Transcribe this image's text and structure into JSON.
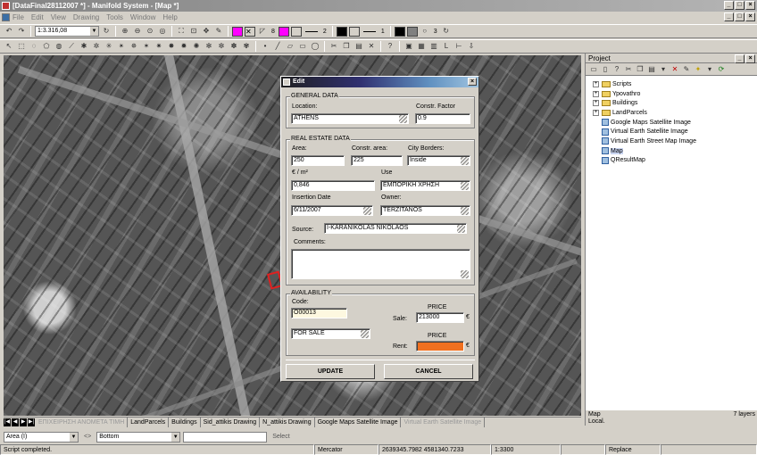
{
  "window": {
    "title": "[DataFinal28112007 *] - Manifold System - [Map *]"
  },
  "menu": [
    "File",
    "Edit",
    "View",
    "Drawing",
    "Tools",
    "Window",
    "Help"
  ],
  "toolbar": {
    "scale": "1:3.316,08",
    "swatch_pink": "#ff00ff",
    "num8": "8",
    "num2": "2",
    "num1": "1",
    "num3": "3"
  },
  "map": {
    "tabs": [
      "ΕΠΙΧΕΙΡΗΣΗ ΑΝΟΜΕΤΑ ΤΙΜΗ",
      "LandParcels",
      "Buildings",
      "Sid_attikis Drawing",
      "N_attikis Drawing",
      "Google Maps Satellite Image",
      "Virtual Earth Satellite Image"
    ]
  },
  "filter": {
    "field": "Area (I)",
    "op": "<>",
    "value": "Bottom",
    "select_label": "Select"
  },
  "status": {
    "message": "Script completed.",
    "projection": "Mercator",
    "coords": "2639345.7982  4581340.7233",
    "scale": "1:3300",
    "mode": "Replace"
  },
  "project": {
    "title": "Project",
    "items": [
      {
        "label": "Scripts",
        "kind": "folder",
        "expand": "+"
      },
      {
        "label": "Ypovathro",
        "kind": "folder",
        "expand": "+"
      },
      {
        "label": "Buildings",
        "kind": "folder",
        "expand": "+"
      },
      {
        "label": "LandParcels",
        "kind": "folder",
        "expand": "+"
      },
      {
        "label": "Google Maps Satellite Image",
        "kind": "image",
        "expand": ""
      },
      {
        "label": "Virtual Earth Satellite Image",
        "kind": "image",
        "expand": ""
      },
      {
        "label": "Virtual Earth Street Map Image",
        "kind": "image",
        "expand": ""
      },
      {
        "label": "Map",
        "kind": "map",
        "expand": ""
      },
      {
        "label": "QResultMap",
        "kind": "map",
        "expand": ""
      }
    ],
    "footer_left": "Map",
    "footer_left2": "Local.",
    "footer_right": "7 layers"
  },
  "dialog": {
    "title": "Edit",
    "general": {
      "legend": "GENERAL DATA",
      "location_label": "Location:",
      "location": "ATHENS",
      "factor_label": "Constr. Factor",
      "factor": "0.9"
    },
    "estate": {
      "legend": "REAL ESTATE DATA",
      "area_label": "Area:",
      "area": "250",
      "constr_label": "Constr. area:",
      "constr": "225",
      "borders_label": "City Borders:",
      "borders": "Inside",
      "eur_label": "€ / m²",
      "eur": "0,846",
      "use_label": "Use",
      "use": "ΕΜΠΟΡΙΚΗ ΧΡΗΣΗ",
      "date_label": "Insertion Date",
      "date": "6/11/2007",
      "owner_label": "Owner:",
      "owner": "TERZITANOS",
      "source_label": "Source:",
      "source": "I-KARANIKOLAS NIKOLAOS",
      "comments_label": "Comments:"
    },
    "avail": {
      "legend": "AVAILABILITY",
      "code_label": "Code:",
      "code": "O00013",
      "status": "FOR SALE",
      "price_label": "PRICE",
      "sale_label": "Sale:",
      "sale": "213000",
      "rent_price_label": "PRICE",
      "rent_label": "Rent:",
      "rent": "",
      "currency": "€",
      "rent_color": "#f07020"
    },
    "update": "UPDATE",
    "cancel": "CANCEL"
  }
}
